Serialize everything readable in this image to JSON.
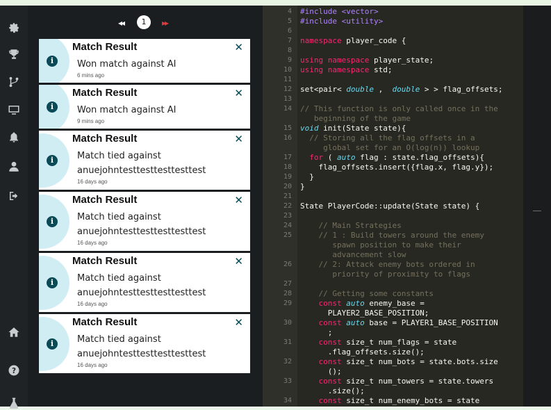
{
  "sidebar": {
    "items": [
      "gear-icon",
      "trophy-icon",
      "branch-icon",
      "monitor-icon",
      "bell-icon",
      "user-icon",
      "signout-icon"
    ],
    "bottom_items": [
      "home-icon",
      "help-icon",
      "flask-icon"
    ]
  },
  "pagination": {
    "prev": "◂◂",
    "page": "1",
    "next": "▸▸"
  },
  "notifications": [
    {
      "title": "Match Result",
      "lines": [
        "Won match against AI"
      ],
      "time": "6 mins ago"
    },
    {
      "title": "Match Result",
      "lines": [
        "Won match against AI"
      ],
      "time": "9 mins ago"
    },
    {
      "title": "Match Result",
      "lines": [
        "Match tied against",
        "anuejohntesttesttesttesttest"
      ],
      "time": "16 days ago"
    },
    {
      "title": "Match Result",
      "lines": [
        "Match tied against",
        "anuejohntesttesttesttesttest"
      ],
      "time": "16 days ago"
    },
    {
      "title": "Match Result",
      "lines": [
        "Match tied against",
        "anuejohntesttesttesttesttest"
      ],
      "time": "16 days ago"
    },
    {
      "title": "Match Result",
      "lines": [
        "Match tied against",
        "anuejohntesttesttesttesttest"
      ],
      "time": "16 days ago"
    }
  ],
  "editor": {
    "lines": [
      {
        "n": "4",
        "segs": [
          [
            "pp",
            "#include <vector>"
          ]
        ]
      },
      {
        "n": "5",
        "segs": [
          [
            "pp",
            "#include <utility>"
          ]
        ]
      },
      {
        "n": "6",
        "segs": []
      },
      {
        "n": "7",
        "segs": [
          [
            "kw",
            "namespace"
          ],
          [
            "",
            "player_code {"
          ]
        ]
      },
      {
        "n": "8",
        "segs": []
      },
      {
        "n": "9",
        "segs": [
          [
            "kw",
            "using namespace"
          ],
          [
            "",
            "player_state;"
          ]
        ]
      },
      {
        "n": "10",
        "segs": [
          [
            "kw",
            "using namespace"
          ],
          [
            "",
            "std;"
          ]
        ]
      },
      {
        "n": "11",
        "segs": []
      },
      {
        "n": "12",
        "segs": [
          [
            "",
            "set<pair<"
          ],
          [
            "ty",
            "double"
          ],
          [
            "",
            ", "
          ],
          [
            "ty",
            "double"
          ],
          [
            "",
            "> > flag_offsets;"
          ]
        ]
      },
      {
        "n": "13",
        "segs": []
      },
      {
        "n": "14",
        "segs": [
          [
            "cm",
            "// This function is only called once in the"
          ]
        ]
      },
      {
        "n": "",
        "segs": [
          [
            "cm",
            "   beginning of the game"
          ]
        ]
      },
      {
        "n": "15",
        "segs": [
          [
            "ty",
            "void"
          ],
          [
            "",
            "init(State state){"
          ]
        ]
      },
      {
        "n": "16",
        "segs": [
          [
            "cm",
            "  // Storing all the flag offsets in a"
          ]
        ]
      },
      {
        "n": "",
        "segs": [
          [
            "cm",
            "     global set for an O(log(n)) lookup"
          ]
        ]
      },
      {
        "n": "17",
        "segs": [
          [
            "kw",
            "  for"
          ],
          [
            "",
            "("
          ],
          [
            "ty",
            "auto"
          ],
          [
            "",
            "flag : state.flag_offsets){"
          ]
        ]
      },
      {
        "n": "18",
        "segs": [
          [
            "",
            "    flag_offsets.insert({flag.x, flag.y});"
          ]
        ]
      },
      {
        "n": "19",
        "segs": [
          [
            "",
            "  }"
          ]
        ]
      },
      {
        "n": "20",
        "segs": [
          [
            "",
            "}"
          ]
        ]
      },
      {
        "n": "21",
        "segs": []
      },
      {
        "n": "22",
        "segs": [
          [
            "",
            "State PlayerCode::update(State state) {"
          ]
        ]
      },
      {
        "n": "23",
        "segs": []
      },
      {
        "n": "24",
        "segs": [
          [
            "cm",
            "    // Main Strategies"
          ]
        ]
      },
      {
        "n": "25",
        "segs": [
          [
            "cm",
            "    // 1 : Build towers around the enemy"
          ]
        ]
      },
      {
        "n": "",
        "segs": [
          [
            "cm",
            "       spawn position to make their"
          ]
        ]
      },
      {
        "n": "",
        "segs": [
          [
            "cm",
            "       advancement slow"
          ]
        ]
      },
      {
        "n": "26",
        "segs": [
          [
            "cm",
            "    // 2: Attack enemy bots ordered in"
          ]
        ]
      },
      {
        "n": "",
        "segs": [
          [
            "cm",
            "       priority of proximity to flags"
          ]
        ]
      },
      {
        "n": "27",
        "segs": []
      },
      {
        "n": "28",
        "segs": [
          [
            "cm",
            "    // Getting some constants"
          ]
        ]
      },
      {
        "n": "29",
        "segs": [
          [
            "kw",
            "    const"
          ],
          [
            "ty",
            "auto"
          ],
          [
            "",
            "enemy_base ="
          ]
        ]
      },
      {
        "n": "",
        "segs": [
          [
            "",
            "      PLAYER2_BASE_POSITION;"
          ]
        ]
      },
      {
        "n": "30",
        "segs": [
          [
            "kw",
            "    const"
          ],
          [
            "ty",
            "auto"
          ],
          [
            "",
            "base = PLAYER1_BASE_POSITION"
          ]
        ]
      },
      {
        "n": "",
        "segs": [
          [
            "",
            "      ;"
          ]
        ]
      },
      {
        "n": "31",
        "segs": [
          [
            "kw",
            "    const"
          ],
          [
            "",
            "size_t num_flags = state"
          ]
        ]
      },
      {
        "n": "",
        "segs": [
          [
            "",
            "      .flag_offsets.size();"
          ]
        ]
      },
      {
        "n": "32",
        "segs": [
          [
            "kw",
            "    const"
          ],
          [
            "",
            "size_t num_bots = state.bots.size"
          ]
        ]
      },
      {
        "n": "",
        "segs": [
          [
            "",
            "      ();"
          ]
        ]
      },
      {
        "n": "33",
        "segs": [
          [
            "kw",
            "    const"
          ],
          [
            "",
            "size_t num_towers = state.towers"
          ]
        ]
      },
      {
        "n": "",
        "segs": [
          [
            "",
            "      .size();"
          ]
        ]
      },
      {
        "n": "34",
        "segs": [
          [
            "kw",
            "    const"
          ],
          [
            "",
            "size_t num_enemy_bots = state"
          ]
        ]
      }
    ]
  }
}
